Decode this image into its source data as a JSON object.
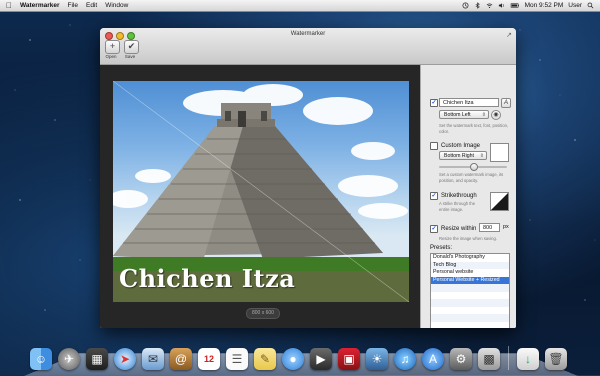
{
  "menubar": {
    "app_name": "Watermarker",
    "menus": [
      "File",
      "Edit",
      "Window"
    ],
    "clock": "Mon 9:52 PM",
    "user": "User"
  },
  "window": {
    "title": "Watermarker",
    "toolbar": {
      "open_label": "Open",
      "save_label": "Save"
    },
    "image_size": "800 x 600",
    "watermark_text": "Chichen Itza"
  },
  "inspector": {
    "text_watermark": {
      "enabled": true,
      "value": "Chichen Itza",
      "position": "Bottom Left",
      "help": "Set the watermark text, font, position, color."
    },
    "custom_image": {
      "enabled": false,
      "label": "Custom Image",
      "position": "Bottom Right",
      "help": "Set a custom watermark image, its position, and opacity."
    },
    "strikethrough": {
      "enabled": true,
      "label": "Strikethrough",
      "help": "A strike through the entire image."
    },
    "resize": {
      "enabled": true,
      "label": "Resize within",
      "value": "800",
      "unit": "px",
      "help": "Resize the image when saving."
    },
    "presets": {
      "title": "Presets:",
      "items": [
        "Donald's Photography",
        "Tech Blog",
        "Personal website",
        "Personal Website + Resized"
      ],
      "selected_index": 3,
      "add_label": "+",
      "remove_label": "−"
    }
  },
  "colors": {
    "accent": "#3875d7",
    "desktop": "#0d2a4f"
  }
}
